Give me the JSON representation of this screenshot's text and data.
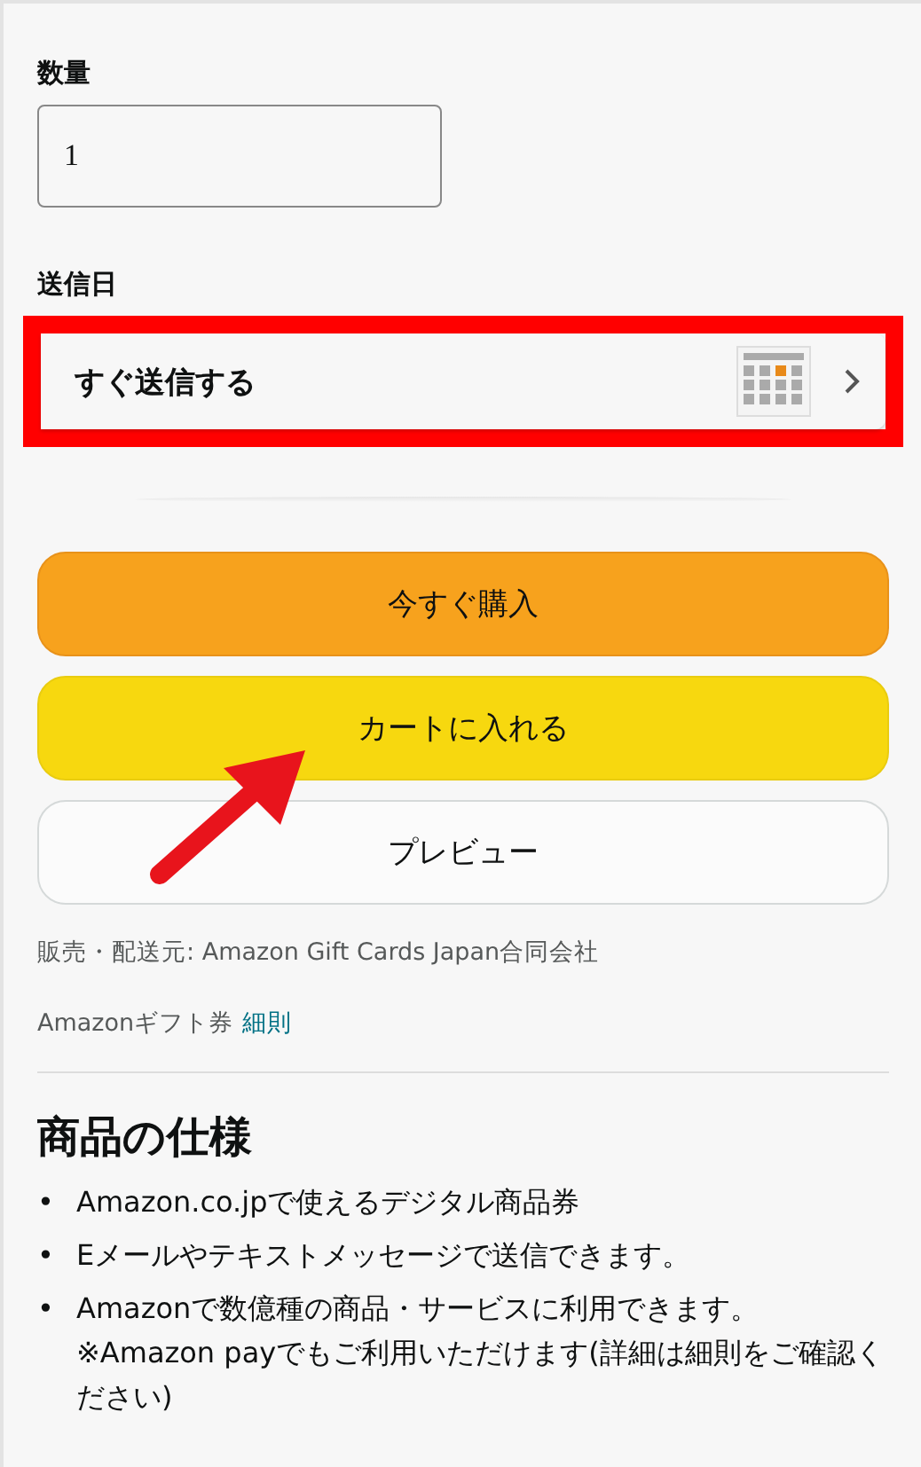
{
  "quantity": {
    "label": "数量",
    "value": "1"
  },
  "send_date": {
    "label": "送信日",
    "value": "すぐ送信する",
    "highlighted": true
  },
  "buttons": [
    {
      "label": "今すぐ購入",
      "kind": "buy"
    },
    {
      "label": "カートに入れる",
      "kind": "cart"
    },
    {
      "label": "プレビュー",
      "kind": "plain"
    }
  ],
  "annotation_arrow": true,
  "seller": "販売・配送元: Amazon Gift Cards Japan合同会社",
  "terms": {
    "text": "Amazonギフト券",
    "link": "細則"
  },
  "specs": {
    "title": "商品の仕様",
    "items": [
      {
        "bullet": "•",
        "text": "Amazon.co.jpで使えるデジタル商品券"
      },
      {
        "bullet": "•",
        "text": "Eメールやテキストメッセージで送信できます。"
      },
      {
        "bullet": "•",
        "text": "Amazonで数億種の商品・サービスに利用できます。※Amazon payでもご利用いただけます(詳細は細則をご確認ください)"
      }
    ]
  }
}
